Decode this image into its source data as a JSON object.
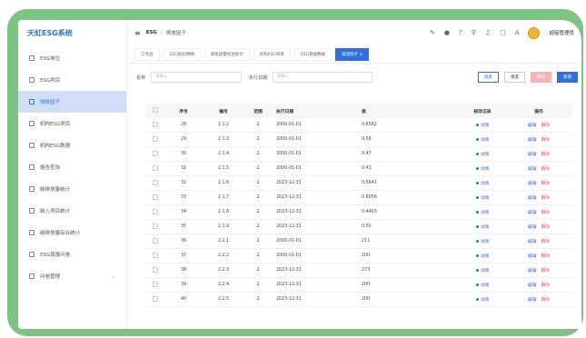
{
  "sidebar": {
    "brand": "天虹ESG系统",
    "items": [
      {
        "label": "ESG单位",
        "icon": "document-icon",
        "active": false
      },
      {
        "label": "ESG项目",
        "icon": "document-icon",
        "active": false
      },
      {
        "label": "排放因子",
        "icon": "gear-icon",
        "active": true
      },
      {
        "label": "机构ESG项目",
        "icon": "document-icon",
        "active": false
      },
      {
        "label": "机构ESG数据",
        "icon": "chart-icon",
        "active": false
      },
      {
        "label": "报告查询",
        "icon": "document-icon",
        "active": false
      },
      {
        "label": "碳排放量统计",
        "icon": "document-icon",
        "active": false
      },
      {
        "label": "碳入项目统计",
        "icon": "document-icon",
        "active": false
      },
      {
        "label": "碳排放量综合统计",
        "icon": "document-icon",
        "active": false
      },
      {
        "label": "ESG填报问卷",
        "icon": "document-icon",
        "active": false
      },
      {
        "label": "问卷管理",
        "icon": "user-icon",
        "active": false
      }
    ]
  },
  "topbar": {
    "crumb_root": "ESG",
    "crumb_current": "排放因子",
    "user_name": "超级管理员"
  },
  "tabs": [
    {
      "label": "工作台",
      "active": false
    },
    {
      "label": "ESG指标明细",
      "active": false
    },
    {
      "label": "碳排放量综合统计",
      "active": false
    },
    {
      "label": "机构ESG项目",
      "active": false
    },
    {
      "label": "ESG基础数据",
      "active": false
    },
    {
      "label": "排放因子 ×",
      "active": true
    }
  ],
  "search": {
    "label1": "名称",
    "placeholder1": "请输入",
    "label2": "执行日期",
    "placeholder2": "请输入",
    "search_btn": "搜索",
    "reset_btn": "重置",
    "delete_btn": "删除",
    "add_btn": "新增"
  },
  "table": {
    "headers": [
      "序号",
      "编号",
      "范围",
      "执行日期",
      "值",
      "修改记录",
      "操作"
    ],
    "view_label": "详情",
    "edit_label": "编辑",
    "del_label": "删除",
    "rows": [
      {
        "no": "28",
        "code": "2.1.2",
        "scope": "2",
        "date": "2000-01-01",
        "value": "0.6562"
      },
      {
        "no": "29",
        "code": "2.1.3",
        "scope": "2",
        "date": "2000-01-01",
        "value": "0.58"
      },
      {
        "no": "30",
        "code": "2.1.4",
        "scope": "2",
        "date": "2000-01-01",
        "value": "0.47"
      },
      {
        "no": "31",
        "code": "2.1.5",
        "scope": "2",
        "date": "2000-01-01",
        "value": "0.43"
      },
      {
        "no": "32",
        "code": "2.1.6",
        "scope": "2",
        "date": "2023-12-31",
        "value": "0.5641"
      },
      {
        "no": "33",
        "code": "2.1.7",
        "scope": "2",
        "date": "2023-12-31",
        "value": "0.6056"
      },
      {
        "no": "34",
        "code": "2.1.8",
        "scope": "2",
        "date": "2023-12-31",
        "value": "0.4403"
      },
      {
        "no": "35",
        "code": "2.1.9",
        "scope": "2",
        "date": "2023-12-31",
        "value": "0.55"
      },
      {
        "no": "36",
        "code": "2.2.1",
        "scope": "2",
        "date": "2000-01-01",
        "value": "211"
      },
      {
        "no": "37",
        "code": "2.2.2",
        "scope": "2",
        "date": "2000-01-01",
        "value": "200"
      },
      {
        "no": "38",
        "code": "2.2.3",
        "scope": "2",
        "date": "2023-12-31",
        "value": "273"
      },
      {
        "no": "39",
        "code": "2.2.4",
        "scope": "2",
        "date": "2023-12-31",
        "value": "200"
      },
      {
        "no": "40",
        "code": "2.2.5",
        "scope": "2",
        "date": "2023-12-31",
        "value": "200"
      }
    ]
  }
}
